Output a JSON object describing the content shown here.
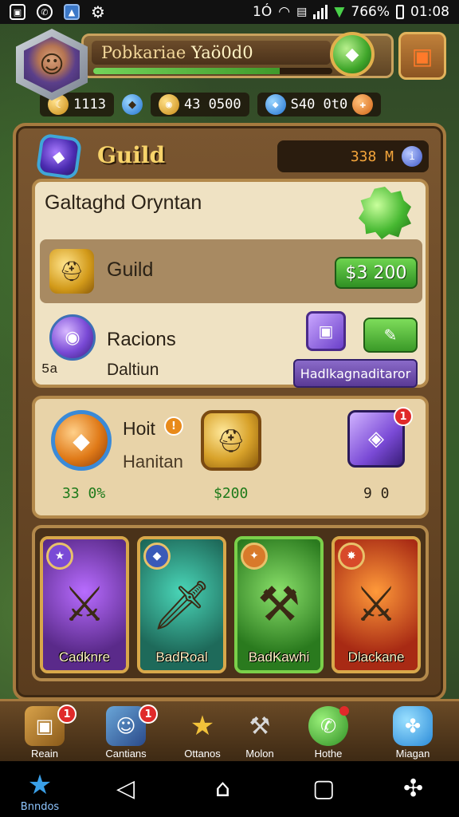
{
  "status_bar": {
    "left_icons": [
      "image-icon",
      "whatsapp-icon",
      "gallery-icon",
      "settings-icon"
    ],
    "notif_text": "1Ó",
    "battery": "766%",
    "time": "01:08"
  },
  "header": {
    "player_name": "Pobkariae",
    "player_level": "Yaö0d0",
    "xp_fraction": 0.78
  },
  "resources": [
    {
      "icon": "crescent-icon",
      "value": "1113"
    },
    {
      "icon": "gem-blue-icon",
      "value": ""
    },
    {
      "icon": "coin-icon",
      "value": "43 0500"
    },
    {
      "icon": "crystal-icon",
      "value": "S40 0t0"
    }
  ],
  "guild": {
    "title": "Guild",
    "count": "338 M",
    "card_title": "Galtaghd Oryntan",
    "row_label": "Guild",
    "row_price": "$3 200",
    "race_label": "Racions",
    "race_small": "5a",
    "race_sub": "Daltiun",
    "race_button": "Hadlkagnaditaror"
  },
  "rewards": {
    "title": "Hoit",
    "subtitle": "Hanitan",
    "items": [
      {
        "value": "33 0%",
        "color": "#1e7a1a"
      },
      {
        "value": "$200",
        "color": "#1e7a1a"
      },
      {
        "value": "9 0",
        "color": "#2b2216",
        "badge": "1"
      }
    ]
  },
  "heroes": [
    {
      "name": "Cadknre",
      "bg": "#5a2a8a",
      "accent": "#b86cff",
      "badge_bg": "#7a4ad6"
    },
    {
      "name": "BadRoal",
      "bg": "#1e6a5a",
      "accent": "#4ad6b8",
      "badge_bg": "#3a5ab8"
    },
    {
      "name": "BadKawhi",
      "bg": "#2a7a1e",
      "accent": "#8ae06a",
      "badge_bg": "#d87a2a"
    },
    {
      "name": "Dlackane",
      "bg": "#a82a14",
      "accent": "#ff9a3a",
      "badge_bg": "#d84a2a"
    }
  ],
  "bottom_nav": [
    {
      "label": "Reain",
      "badge": "1"
    },
    {
      "label": "Cantians",
      "badge": "1"
    },
    {
      "label": "Ottanos",
      "badge": ""
    },
    {
      "label": "Molon",
      "badge": ""
    },
    {
      "label": "Hothe",
      "badge": ""
    },
    {
      "label": "Miagan",
      "badge": ""
    }
  ],
  "system_bar": {
    "home_label": "Bnndos"
  }
}
